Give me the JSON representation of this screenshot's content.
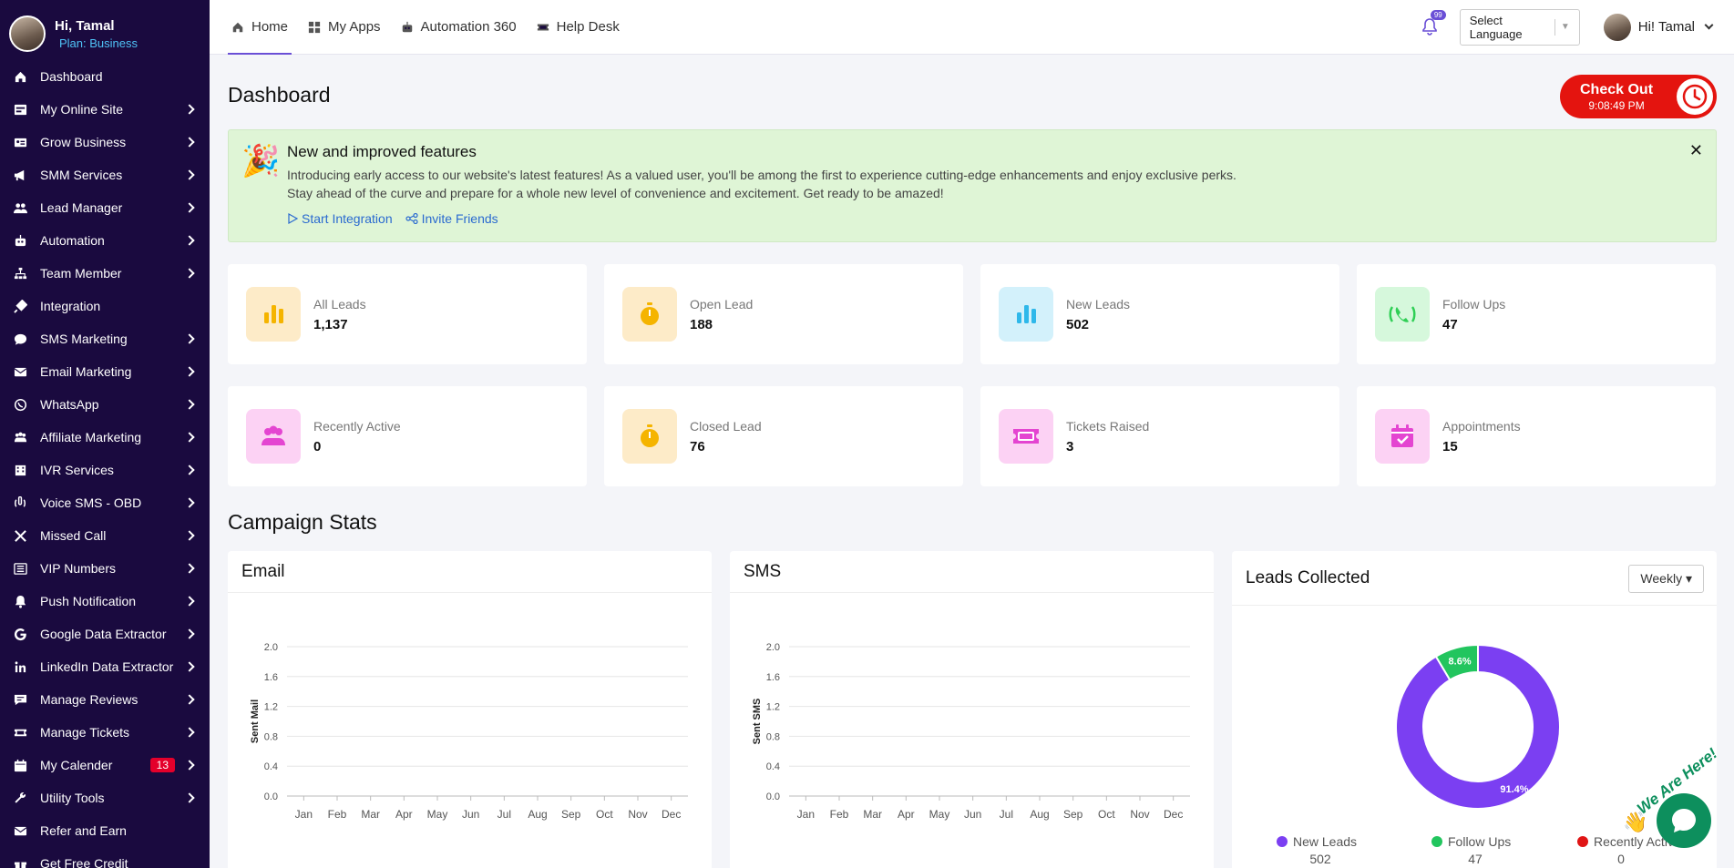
{
  "profile": {
    "name": "Hi, Tamal",
    "plan": "Plan: Business"
  },
  "sidebar": {
    "items": [
      {
        "label": "Dashboard",
        "icon": "home-icon",
        "chevron": false
      },
      {
        "label": "My Online Site",
        "icon": "site-icon",
        "chevron": true
      },
      {
        "label": "Grow Business",
        "icon": "business-card-icon",
        "chevron": true
      },
      {
        "label": "SMM Services",
        "icon": "megaphone-icon",
        "chevron": true
      },
      {
        "label": "Lead Manager",
        "icon": "users-icon",
        "chevron": true
      },
      {
        "label": "Automation",
        "icon": "robot-icon",
        "chevron": true
      },
      {
        "label": "Team Member",
        "icon": "sitemap-icon",
        "chevron": true
      },
      {
        "label": "Integration",
        "icon": "plug-icon",
        "chevron": false
      },
      {
        "label": "SMS Marketing",
        "icon": "chat-icon",
        "chevron": true
      },
      {
        "label": "Email Marketing",
        "icon": "envelope-icon",
        "chevron": true
      },
      {
        "label": "WhatsApp",
        "icon": "whatsapp-icon",
        "chevron": true
      },
      {
        "label": "Affiliate Marketing",
        "icon": "group-icon",
        "chevron": true
      },
      {
        "label": "IVR Services",
        "icon": "building-icon",
        "chevron": true
      },
      {
        "label": "Voice SMS - OBD",
        "icon": "voice-icon",
        "chevron": true
      },
      {
        "label": "Missed Call",
        "icon": "missed-call-icon",
        "chevron": true
      },
      {
        "label": "VIP Numbers",
        "icon": "list-icon",
        "chevron": true
      },
      {
        "label": "Push Notification",
        "icon": "bell-icon",
        "chevron": true
      },
      {
        "label": "Google Data Extractor",
        "icon": "google-icon",
        "chevron": true
      },
      {
        "label": "LinkedIn Data Extractor",
        "icon": "linkedin-icon",
        "chevron": true
      },
      {
        "label": "Manage Reviews",
        "icon": "review-icon",
        "chevron": true
      },
      {
        "label": "Manage Tickets",
        "icon": "ticket-icon",
        "chevron": true
      },
      {
        "label": "My Calender",
        "icon": "calendar-icon",
        "chevron": true,
        "badge": "13"
      },
      {
        "label": "Utility Tools",
        "icon": "wrench-icon",
        "chevron": true
      },
      {
        "label": "Refer and Earn",
        "icon": "mail-icon",
        "chevron": false
      },
      {
        "label": "Get Free Credit",
        "icon": "gift-icon",
        "chevron": false
      }
    ]
  },
  "topbar": {
    "tabs": [
      {
        "label": "Home",
        "icon": "home-icon",
        "active": true
      },
      {
        "label": "My Apps",
        "icon": "grid-icon",
        "active": false
      },
      {
        "label": "Automation 360",
        "icon": "robot-icon",
        "active": false
      },
      {
        "label": "Help Desk",
        "icon": "ticket-icon",
        "active": false
      }
    ],
    "notification_count": "99",
    "language": "Select Language",
    "user_greeting": "Hi! Tamal"
  },
  "page": {
    "title": "Dashboard"
  },
  "checkout": {
    "label": "Check Out",
    "time": "9:08:49 PM"
  },
  "banner": {
    "title": "New and improved features",
    "line1": "Introducing early access to our website's latest features! As a valued user, you'll be among the first to experience cutting-edge enhancements and enjoy exclusive perks.",
    "line2": "Stay ahead of the curve and prepare for a whole new level of convenience and excitement. Get ready to be amazed!",
    "link1": "Start Integration",
    "link2": "Invite Friends",
    "close": "✕"
  },
  "stats": [
    {
      "label": "All Leads",
      "value": "1,137",
      "icon": "bar-chart-icon",
      "bg": "#fdebc8",
      "fg": "#f5b400"
    },
    {
      "label": "Open Lead",
      "value": "188",
      "icon": "stopwatch-icon",
      "bg": "#fdebc8",
      "fg": "#f5b400"
    },
    {
      "label": "New Leads",
      "value": "502",
      "icon": "bar-chart-icon",
      "bg": "#d3f1fb",
      "fg": "#2fb8ea"
    },
    {
      "label": "Follow Ups",
      "value": "47",
      "icon": "phone-ring-icon",
      "bg": "#d6f8dc",
      "fg": "#2fcf55"
    },
    {
      "label": "Recently Active",
      "value": "0",
      "icon": "users-icon",
      "bg": "#fcd2f4",
      "fg": "#e445d1"
    },
    {
      "label": "Closed Lead",
      "value": "76",
      "icon": "stopwatch-icon",
      "bg": "#fdebc8",
      "fg": "#f5b400"
    },
    {
      "label": "Tickets Raised",
      "value": "3",
      "icon": "ticket-icon",
      "bg": "#fcd2f4",
      "fg": "#e445d1"
    },
    {
      "label": "Appointments",
      "value": "15",
      "icon": "calendar-check-icon",
      "bg": "#fcd2f4",
      "fg": "#e445d1"
    }
  ],
  "campaign": {
    "title": "Campaign Stats"
  },
  "email_card": {
    "title": "Email"
  },
  "sms_card": {
    "title": "SMS"
  },
  "leads_card": {
    "title": "Leads Collected",
    "period": "Weekly"
  },
  "chart_data": [
    {
      "type": "line",
      "title": "Email",
      "ylabel": "Sent Mail",
      "categories": [
        "Jan",
        "Feb",
        "Mar",
        "Apr",
        "May",
        "Jun",
        "Jul",
        "Aug",
        "Sep",
        "Oct",
        "Nov",
        "Dec"
      ],
      "yticks": [
        "0.0",
        "0.4",
        "0.8",
        "1.2",
        "1.6",
        "2.0"
      ],
      "ylim": [
        0,
        2
      ],
      "series": [
        {
          "values": [
            0,
            0,
            0,
            0,
            0,
            0,
            0,
            0,
            0,
            0,
            0,
            0
          ]
        }
      ]
    },
    {
      "type": "line",
      "title": "SMS",
      "ylabel": "Sent SMS",
      "categories": [
        "Jan",
        "Feb",
        "Mar",
        "Apr",
        "May",
        "Jun",
        "Jul",
        "Aug",
        "Sep",
        "Oct",
        "Nov",
        "Dec"
      ],
      "yticks": [
        "0.0",
        "0.4",
        "0.8",
        "1.2",
        "1.6",
        "2.0"
      ],
      "ylim": [
        0,
        2
      ],
      "series": [
        {
          "values": [
            0,
            0,
            0,
            0,
            0,
            0,
            0,
            0,
            0,
            0,
            0,
            0
          ]
        }
      ]
    },
    {
      "type": "pie",
      "title": "Leads Collected",
      "slices": [
        {
          "name": "New Leads",
          "value": 502,
          "percent": 91.4,
          "label": "91.4%",
          "color": "#7b3ff2"
        },
        {
          "name": "Follow Ups",
          "value": 47,
          "percent": 8.6,
          "label": "8.6%",
          "color": "#22c55e"
        },
        {
          "name": "Recently Active",
          "value": 0,
          "percent": 0,
          "label": "",
          "color": "#e01515"
        }
      ],
      "legend_values": [
        "502",
        "47",
        "0"
      ]
    }
  ],
  "chat": {
    "label": "We Are Here!"
  }
}
